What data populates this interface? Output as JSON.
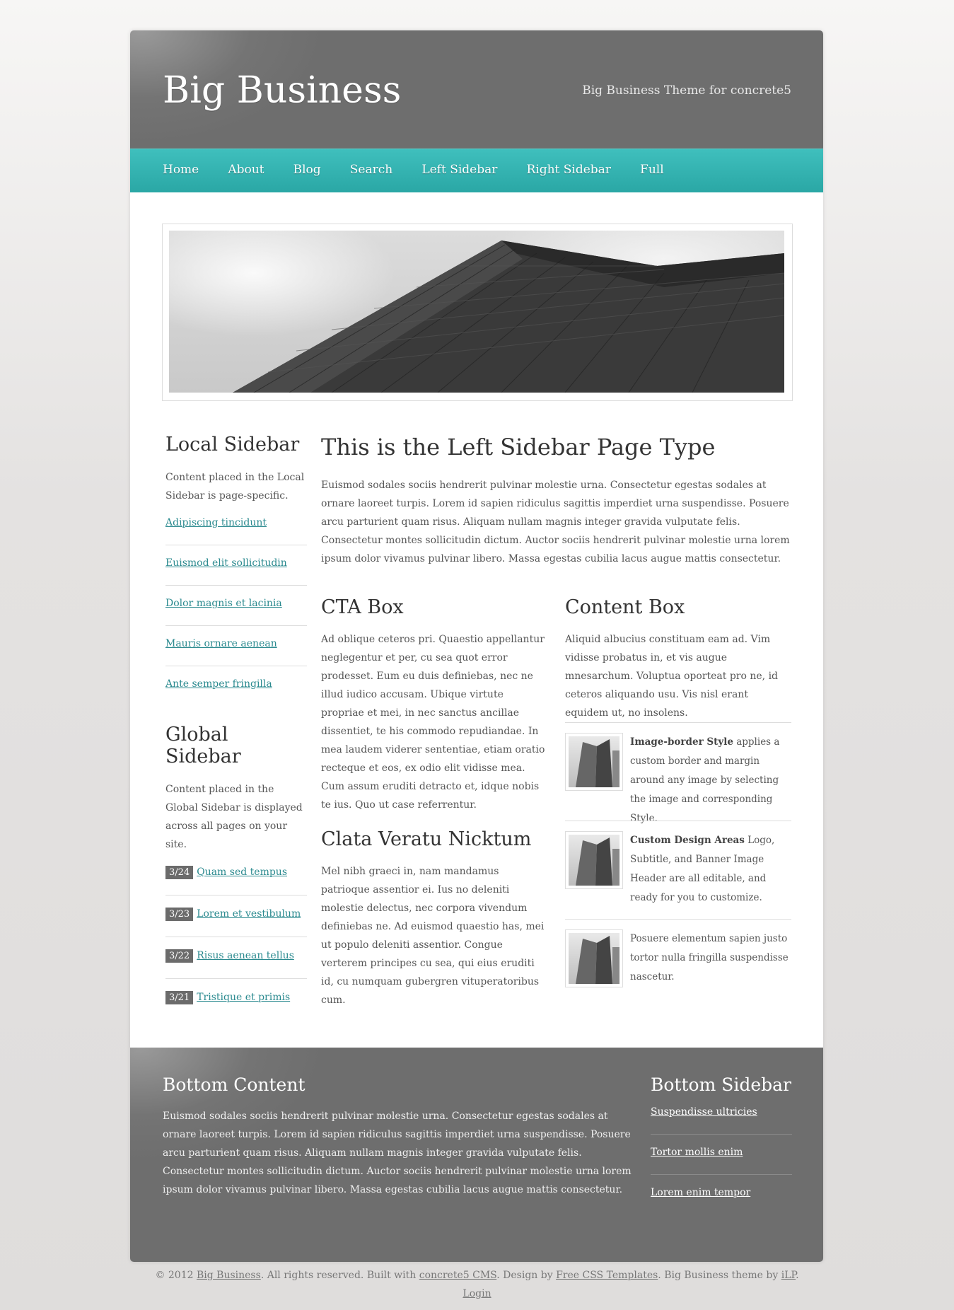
{
  "header": {
    "logo": "Big Business",
    "tagline": "Big Business Theme for concrete5"
  },
  "nav": {
    "items": [
      "Home",
      "About",
      "Blog",
      "Search",
      "Left Sidebar",
      "Right Sidebar",
      "Full"
    ]
  },
  "local_sidebar": {
    "title": "Local Sidebar",
    "text": "Content placed in the Local Sidebar is page-specific.",
    "links": [
      "Adipiscing tincidunt",
      "Euismod elit sollicitudin",
      "Dolor magnis et lacinia",
      "Mauris ornare aenean",
      "Ante semper fringilla"
    ]
  },
  "global_sidebar": {
    "title": "Global Sidebar",
    "text": "Content placed in the Global Sidebar is displayed across all pages on your site.",
    "posts": [
      {
        "date": "3/24",
        "title": "Quam sed tempus"
      },
      {
        "date": "3/23",
        "title": "Lorem et vestibulum"
      },
      {
        "date": "3/22",
        "title": "Risus aenean tellus"
      },
      {
        "date": "3/21",
        "title": "Tristique et primis"
      }
    ]
  },
  "main": {
    "title": "This is the Left Sidebar Page Type",
    "intro": "Euismod sodales sociis hendrerit pulvinar molestie urna. Consectetur egestas sodales at ornare laoreet turpis. Lorem id sapien ridiculus sagittis imperdiet urna suspendisse. Posuere arcu parturient quam risus. Aliquam nullam magnis integer gravida vulputate felis. Consectetur montes sollicitudin dictum. Auctor sociis hendrerit pulvinar molestie urna lorem ipsum dolor vivamus pulvinar libero. Massa egestas cubilia lacus augue mattis consectetur.",
    "cta": {
      "title": "CTA Box",
      "text": "Ad oblique ceteros pri. Quaestio appellantur neglegentur et per, cu sea quot error prodesset. Eum eu duis definiebas, nec ne illud iudico accusam. Ubique virtute propriae et mei, in nec sanctus ancillae dissentiet, te his commodo repudiandae. In mea laudem viderer sententiae, etiam oratio recteque et eos, ex odio elit vidisse mea. Cum assum eruditi detracto et, idque nobis te ius. Quo ut case referrentur."
    },
    "clata": {
      "title": "Clata Veratu Nicktum",
      "text": "Mel nibh graeci in, nam mandamus patrioque assentior ei. Ius no deleniti molestie delectus, nec corpora vivendum definiebas ne. Ad euismod quaestio has, mei ut populo deleniti assentior. Congue verterem principes cu sea, qui eius eruditi id, cu numquam gubergren vituperatoribus cum."
    },
    "content_box": {
      "title": "Content Box",
      "text": "Aliquid albucius constituam eam ad. Vim vidisse probatus in, et vis augue mnesarchum. Voluptua oporteat pro ne, id ceteros aliquando usu. Vis nisl erant equidem ut, no insolens.",
      "features": [
        {
          "bold": "Image-border Style",
          "text": " applies a custom border and margin around any image by selecting the image and corresponding Style."
        },
        {
          "bold": "Custom Design Areas",
          "text": " Logo, Subtitle, and Banner Image Header are all editable, and ready for you to customize."
        },
        {
          "bold": "",
          "text": "Posuere elementum sapien justo tortor nulla fringilla suspendisse nascetur."
        }
      ]
    }
  },
  "footer": {
    "content_title": "Bottom Content",
    "content_text": "Euismod sodales sociis hendrerit pulvinar molestie urna. Consectetur egestas sodales at ornare laoreet turpis. Lorem id sapien ridiculus sagittis imperdiet urna suspendisse. Posuere arcu parturient quam risus. Aliquam nullam magnis integer gravida vulputate felis. Consectetur montes sollicitudin dictum. Auctor sociis hendrerit pulvinar molestie urna lorem ipsum dolor vivamus pulvinar libero. Massa egestas cubilia lacus augue mattis consectetur.",
    "sidebar_title": "Bottom Sidebar",
    "links": [
      "Suspendisse ultricies",
      "Tortor mollis enim",
      "Lorem enim tempor"
    ]
  },
  "copyright": {
    "prefix": "© 2012 ",
    "site_link": "Big Business",
    "mid1": ". All rights reserved. Built with ",
    "cms_link": "concrete5 CMS",
    "mid2": ". Design by ",
    "design_link": "Free CSS Templates",
    "mid3": ". Big Business theme by ",
    "ilp_link": "iLP",
    "suffix": ".",
    "login": "Login"
  },
  "colors": {
    "nav": "#2fb2b0",
    "header": "#717171",
    "link": "#2b8a8f",
    "date_badge": "#6b6b6b"
  }
}
